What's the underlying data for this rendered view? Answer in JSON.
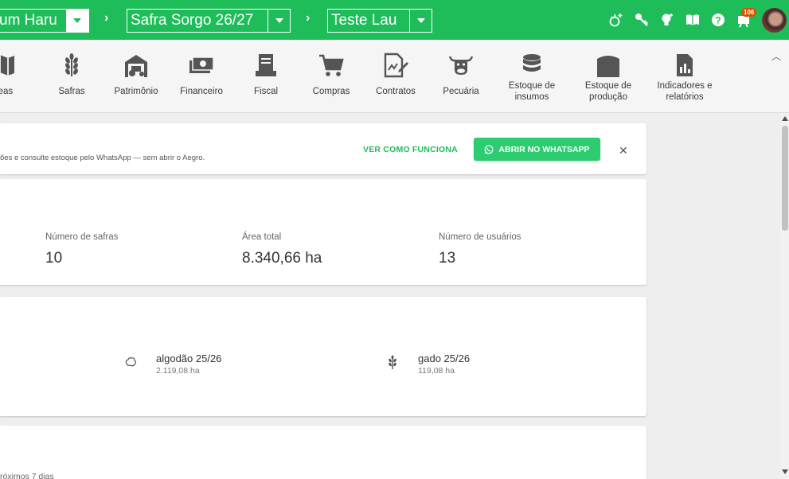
{
  "topbar": {
    "farm_select": "um Haru",
    "season_select": "Safra Sorgo 26/27",
    "user_select": "Teste Lau",
    "notifications_badge": "106"
  },
  "modules": [
    {
      "label": "reas",
      "icon": "map-icon"
    },
    {
      "label": "Safras",
      "icon": "wheat-icon"
    },
    {
      "label": "Patrimônio",
      "icon": "barn-tractor-icon"
    },
    {
      "label": "Financeiro",
      "icon": "cash-icon"
    },
    {
      "label": "Fiscal",
      "icon": "invoice-icon"
    },
    {
      "label": "Compras",
      "icon": "cart-icon"
    },
    {
      "label": "Contratos",
      "icon": "contract-icon"
    },
    {
      "label": "Pecuária",
      "icon": "cow-icon"
    },
    {
      "label": "Estoque de insumos",
      "icon": "database-icon"
    },
    {
      "label": "Estoque de produção",
      "icon": "silo-icon"
    },
    {
      "label": "Indicadores e relatórios",
      "icon": "report-icon"
    }
  ],
  "whatsapp": {
    "text": "ões e consulte estoque pelo WhatsApp — sem abrir o Aegro.",
    "link": "VER COMO FUNCIONA",
    "button": "ABRIR NO WHATSAPP"
  },
  "stats": [
    {
      "label": "Número de safras",
      "value": "10"
    },
    {
      "label": "Área total",
      "value": "8.340,66 ha"
    },
    {
      "label": "Número de usuários",
      "value": "13"
    }
  ],
  "crops": [
    {
      "name": "algodão 25/26",
      "area": "2.119,08 ha",
      "icon": "cotton-icon"
    },
    {
      "name": "gado 25/26",
      "area": "119,08 ha",
      "icon": "wheat-icon"
    }
  ],
  "upcoming": {
    "text": "róximos 7 dias"
  },
  "colors": {
    "brand_green": "#1fbd5a",
    "whatsapp_green": "#2ecc71"
  }
}
